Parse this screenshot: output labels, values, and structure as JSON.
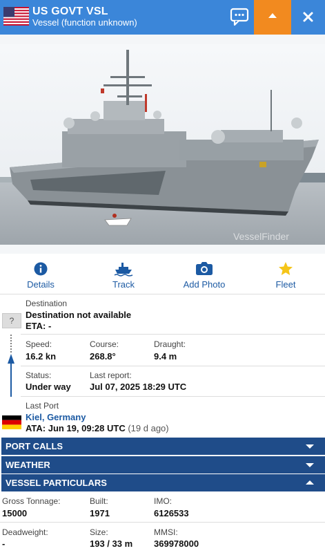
{
  "header": {
    "title": "US GOVT VSL",
    "subtitle": "Vessel (function unknown)",
    "flag": "us-flag-icon",
    "bg_color": "#3b86d9",
    "accent_color": "#f28a1f"
  },
  "photo": {
    "watermark": "VesselFinder"
  },
  "actions": [
    {
      "label": "Details",
      "icon": "info-icon"
    },
    {
      "label": "Track",
      "icon": "ship-icon"
    },
    {
      "label": "Add Photo",
      "icon": "camera-icon"
    },
    {
      "label": "Fleet",
      "icon": "star-icon"
    }
  ],
  "destination": {
    "label": "Destination",
    "value": "Destination not available",
    "eta": "ETA: -",
    "unknown_badge": "?"
  },
  "motion": {
    "speed_label": "Speed:",
    "speed": "16.2 kn",
    "course_label": "Course:",
    "course": "268.8°",
    "draught_label": "Draught:",
    "draught": "9.4 m",
    "status_label": "Status:",
    "status": "Under way",
    "last_report_label": "Last report:",
    "last_report": "Jul 07, 2025 18:29 UTC"
  },
  "last_port": {
    "label": "Last Port",
    "port": "Kiel, Germany",
    "ata": "ATA: Jun 19, 09:28 UTC",
    "ago": "(19 d ago)",
    "flag": "germany-flag-icon"
  },
  "sections": [
    {
      "label": "PORT CALLS",
      "expanded": false
    },
    {
      "label": "WEATHER",
      "expanded": false
    },
    {
      "label": "VESSEL PARTICULARS",
      "expanded": true
    }
  ],
  "particulars": {
    "gross_tonnage_label": "Gross Tonnage:",
    "gross_tonnage": "15000",
    "built_label": "Built:",
    "built": "1971",
    "imo_label": "IMO:",
    "imo": "6126533",
    "deadweight_label": "Deadweight:",
    "deadweight": "-",
    "size_label": "Size:",
    "size": "193 / 33 m",
    "mmsi_label": "MMSI:",
    "mmsi": "369978000"
  }
}
